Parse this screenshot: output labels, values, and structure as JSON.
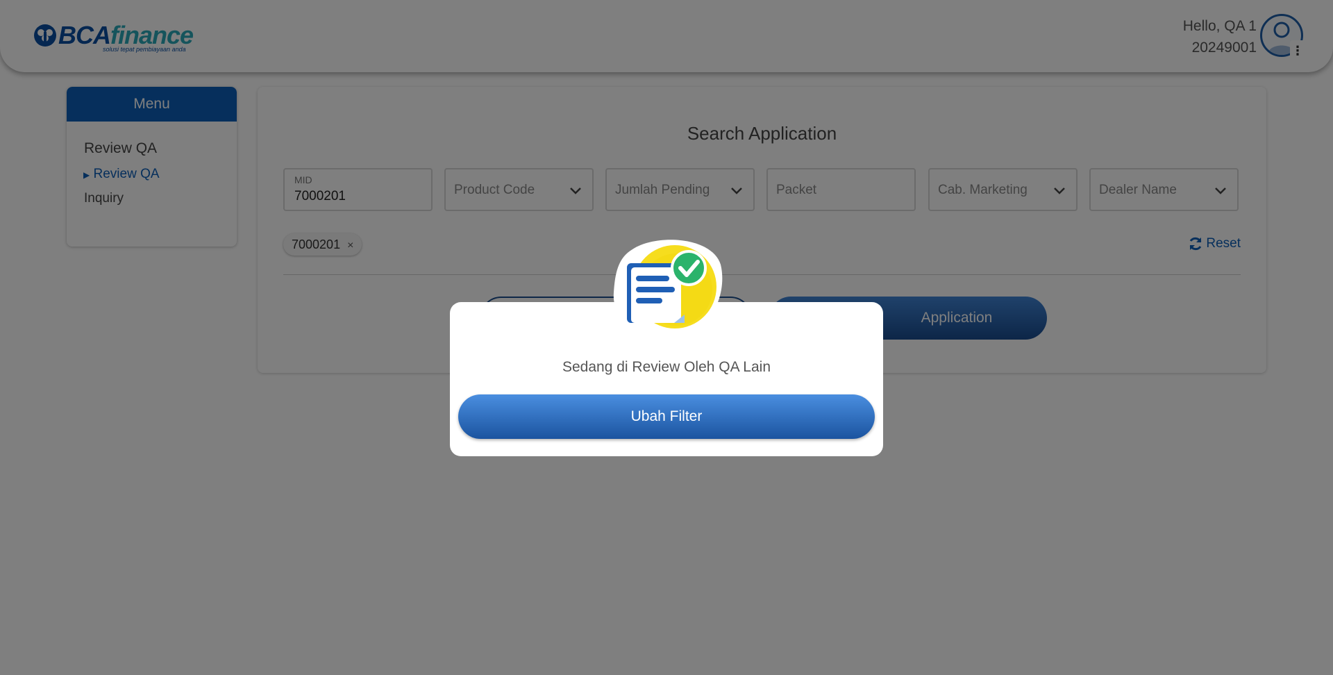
{
  "header": {
    "logo_text_main": "BCA",
    "logo_text_accent": "finance",
    "logo_tagline": "solusi tepat pembiayaan anda",
    "greeting": "Hello, QA 1",
    "user_id": "20249001"
  },
  "sidebar": {
    "title": "Menu",
    "group_label": "Review QA",
    "items": [
      {
        "label": "Review QA",
        "active": true
      },
      {
        "label": "Inquiry",
        "active": false
      }
    ]
  },
  "main": {
    "title": "Search Application",
    "filters": {
      "mid": {
        "label": "MID",
        "value": "7000201"
      },
      "product_code": {
        "placeholder": "Product Code"
      },
      "jumlah_pending": {
        "placeholder": "Jumlah Pending"
      },
      "packet": {
        "placeholder": "Packet"
      },
      "cab_marketing": {
        "placeholder": "Cab. Marketing"
      },
      "dealer_name": {
        "placeholder": "Dealer Name"
      }
    },
    "chips": [
      {
        "label": "7000201",
        "remove_icon": "×"
      }
    ],
    "reset_label": "Reset",
    "search_button_label": "Application"
  },
  "modal": {
    "message": "Sedang di Review Oleh QA Lain",
    "button_label": "Ubah Filter"
  },
  "colors": {
    "primary": "#0d5fb8",
    "overlay": "rgba(0,0,0,0.5)",
    "success": "#2bb36b",
    "illustration_bg": "#f6dd1e"
  }
}
